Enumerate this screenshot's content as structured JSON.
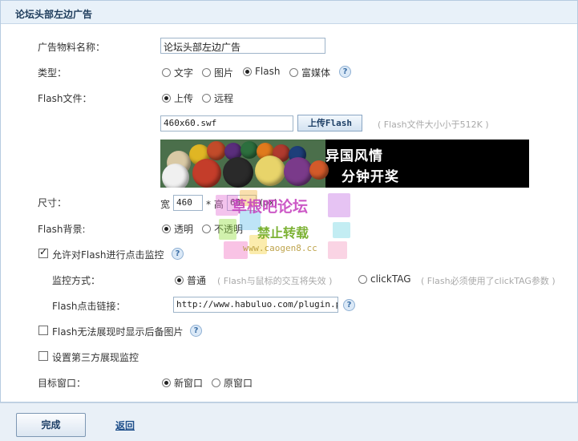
{
  "panel": {
    "title": "论坛头部左边广告"
  },
  "name_row": {
    "label": "广告物料名称：",
    "value": "论坛头部左边广告"
  },
  "type_row": {
    "label": "类型：",
    "options": [
      "文字",
      "图片",
      "Flash",
      "富媒体"
    ],
    "selected": "Flash",
    "help": "?"
  },
  "file_row": {
    "label": "Flash文件：",
    "options": [
      "上传",
      "远程"
    ],
    "selected": "上传",
    "file_value": "460x60.swf",
    "upload_label": "上传Flash",
    "hint": "( Flash文件大小小于512K )"
  },
  "preview": {
    "text1": "异国风情",
    "text2": "分钟开奖",
    "ball_colors": [
      "#d9c9a5",
      "#e0b624",
      "#c24b2a",
      "#5a2e7c",
      "#2d6f3e",
      "#e07a1d",
      "#b03a2e",
      "#1d3f7a",
      "#f0f0f0",
      "#c43d2a",
      "#2a2a2a",
      "#e8d46a",
      "#7a3a8a",
      "#d35a2a"
    ]
  },
  "size_row": {
    "label": "尺寸：",
    "width_label": "宽",
    "width": "460",
    "height_label": "* 高",
    "height": "60",
    "unit": "(px)"
  },
  "bg_row": {
    "label": "Flash背景:",
    "options": [
      "透明",
      "不透明"
    ],
    "selected": "透明"
  },
  "monitor_row": {
    "label": "允许对Flash进行点击监控",
    "checked": true,
    "help": "?",
    "mode_label": "监控方式：",
    "mode_options": [
      "普通",
      "clickTAG"
    ],
    "mode_selected": "普通",
    "mode_hint_1": "( Flash与鼠标的交互将失效 )",
    "mode_hint_2": "( Flash必须使用了clickTAG参数 )",
    "link_label": "Flash点击链接：",
    "link_value": "http://www.habuluo.com/plugin.php?"
  },
  "backup_row": {
    "label": "Flash无法展现时显示后备图片",
    "checked": false,
    "help": "?"
  },
  "third_party_row": {
    "label": "设置第三方展现监控",
    "checked": false
  },
  "target_row": {
    "label": "目标窗口：",
    "options": [
      "新窗口",
      "原窗口"
    ],
    "selected": "新窗口"
  },
  "footer": {
    "done_label": "完成",
    "back_label": "返回"
  },
  "watermark": {
    "line1": "草根吧论坛",
    "line2": "禁止转载",
    "line3": "www.caogen8.cc"
  }
}
